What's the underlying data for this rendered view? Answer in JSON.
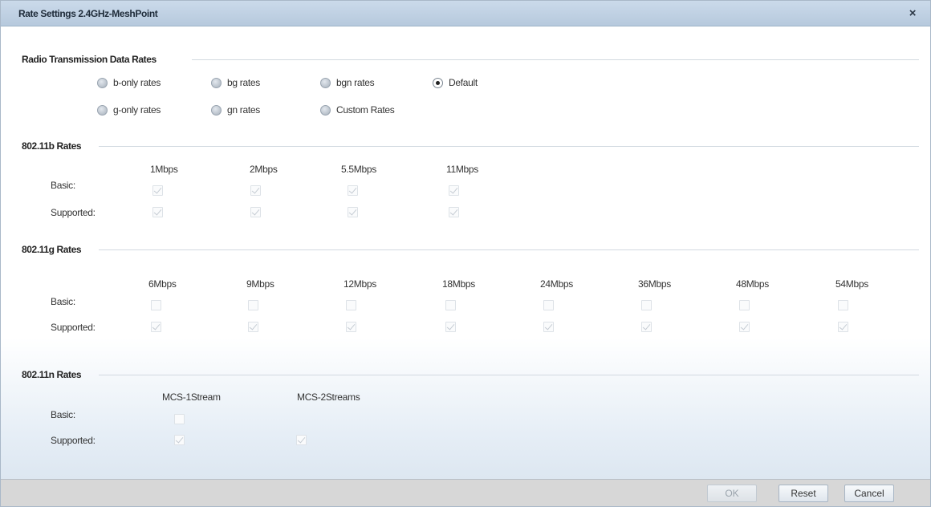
{
  "dialog": {
    "title": "Rate Settings 2.4GHz-MeshPoint",
    "close_glyph": "×"
  },
  "radio_section": {
    "title": "Radio Transmission Data Rates",
    "options": [
      {
        "label": "b-only rates",
        "checked": false
      },
      {
        "label": "bg rates",
        "checked": false
      },
      {
        "label": "bgn rates",
        "checked": false
      },
      {
        "label": "Default",
        "checked": true
      },
      {
        "label": "g-only rates",
        "checked": false
      },
      {
        "label": "gn rates",
        "checked": false
      },
      {
        "label": "Custom Rates",
        "checked": false
      }
    ]
  },
  "rates_11b": {
    "title": "802.11b Rates",
    "columns": [
      "1Mbps",
      "2Mbps",
      "5.5Mbps",
      "11Mbps"
    ],
    "rows": [
      {
        "label": "Basic:",
        "checked": [
          true,
          true,
          true,
          true
        ]
      },
      {
        "label": "Supported:",
        "checked": [
          true,
          true,
          true,
          true
        ]
      }
    ]
  },
  "rates_11g": {
    "title": "802.11g Rates",
    "columns": [
      "6Mbps",
      "9Mbps",
      "12Mbps",
      "18Mbps",
      "24Mbps",
      "36Mbps",
      "48Mbps",
      "54Mbps"
    ],
    "rows": [
      {
        "label": "Basic:",
        "checked": [
          false,
          false,
          false,
          false,
          false,
          false,
          false,
          false
        ]
      },
      {
        "label": "Supported:",
        "checked": [
          true,
          true,
          true,
          true,
          true,
          true,
          true,
          true
        ]
      }
    ]
  },
  "rates_11n": {
    "title": "802.11n Rates",
    "columns": [
      "MCS-1Stream",
      "MCS-2Streams"
    ],
    "rows": [
      {
        "label": "Basic:",
        "checked": [
          false
        ]
      },
      {
        "label": "Supported:",
        "checked": [
          true,
          true
        ]
      }
    ]
  },
  "footer": {
    "ok_label": "OK",
    "reset_label": "Reset",
    "cancel_label": "Cancel"
  },
  "colors": {
    "titlebar": "#c1d2e4",
    "footer": "#d7d7d7"
  }
}
